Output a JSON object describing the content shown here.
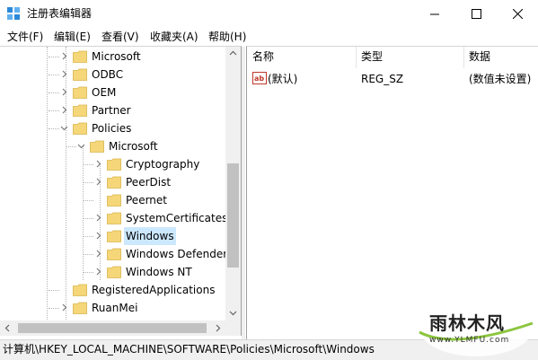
{
  "window": {
    "title": "注册表编辑器",
    "controls": {
      "minimize": "—",
      "maximize": "☐",
      "close": "✕"
    }
  },
  "menu": [
    "文件(F)",
    "编辑(E)",
    "查看(V)",
    "收藏夹(A)",
    "帮助(H)"
  ],
  "tree": {
    "nodes": [
      {
        "label": "Microsoft",
        "expander": "collapsed"
      },
      {
        "label": "ODBC",
        "expander": "collapsed"
      },
      {
        "label": "OEM",
        "expander": "collapsed"
      },
      {
        "label": "Partner",
        "expander": "collapsed"
      },
      {
        "label": "Policies",
        "expander": "expanded"
      },
      {
        "label": "Microsoft",
        "expander": "expanded"
      },
      {
        "label": "Cryptography",
        "expander": "collapsed"
      },
      {
        "label": "PeerDist",
        "expander": "collapsed"
      },
      {
        "label": "Peernet",
        "expander": "none"
      },
      {
        "label": "SystemCertificates",
        "expander": "collapsed"
      },
      {
        "label": "Windows",
        "expander": "collapsed",
        "selected": true
      },
      {
        "label": "Windows Defender",
        "expander": "collapsed"
      },
      {
        "label": "Windows NT",
        "expander": "collapsed"
      },
      {
        "label": "RegisteredApplications",
        "expander": "none"
      },
      {
        "label": "RuanMei",
        "expander": "collapsed"
      }
    ]
  },
  "list": {
    "headers": {
      "name": "名称",
      "type": "类型",
      "data": "数据"
    },
    "rows": [
      {
        "icon": "string-value-icon",
        "name": "(默认)",
        "type": "REG_SZ",
        "data": "(数值未设置)"
      }
    ]
  },
  "status": {
    "path": "计算机\\HKEY_LOCAL_MACHINE\\SOFTWARE\\Policies\\Microsoft\\Windows"
  },
  "watermark": {
    "brand": "雨林木风",
    "url": "www.YLMFU.com"
  },
  "colors": {
    "folder": "#f5d77a",
    "selection": "#cce8ff",
    "accent": "#0078d7"
  }
}
